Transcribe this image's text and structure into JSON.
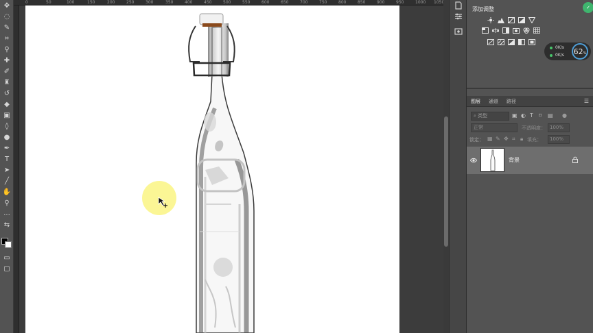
{
  "ruler": {
    "ticks": [
      "0",
      "50",
      "100",
      "150",
      "200",
      "250",
      "300",
      "350",
      "400",
      "450",
      "500",
      "550",
      "600",
      "650",
      "700",
      "750",
      "800",
      "850",
      "900",
      "950",
      "1000",
      "1050"
    ]
  },
  "adjustments": {
    "title": "添加调整"
  },
  "network": {
    "upload": "0K/s",
    "download": "0K/s",
    "percent": "62",
    "percent_unit": "%"
  },
  "layers": {
    "tabs": [
      "图层",
      "通道",
      "路径"
    ],
    "filter_placeholder": "类型",
    "blend_mode": "正常",
    "opacity_label": "不透明度：",
    "opacity_value": "100%",
    "lock_label": "锁定：",
    "fill_label": "填充：",
    "fill_value": "100%",
    "items": [
      {
        "name": "背景",
        "visible": true,
        "locked": true
      }
    ]
  },
  "colors": {
    "accent_green": "#3fb56e",
    "cursor_highlight": "#faf582",
    "panel_bg": "#535353",
    "selected_layer": "#6e6e6e"
  }
}
